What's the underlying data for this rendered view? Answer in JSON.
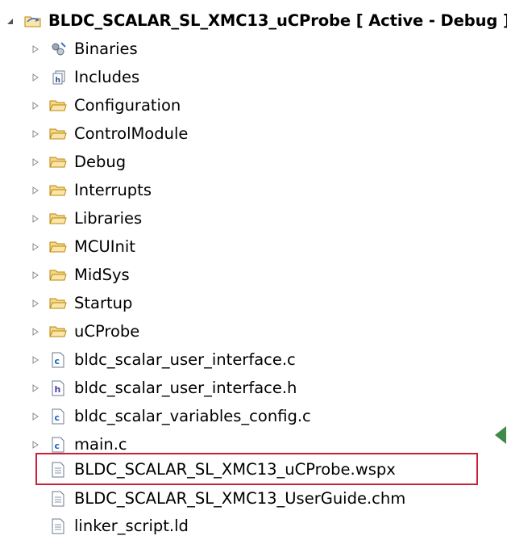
{
  "explorer": {
    "root": {
      "label": "BLDC_SCALAR_SL_XMC13_uCProbe [ Active - Debug ]",
      "icon": "project-folder-icon"
    },
    "items": [
      {
        "label": "Binaries",
        "icon": "binaries-icon",
        "expandable": true
      },
      {
        "label": "Includes",
        "icon": "includes-icon",
        "expandable": true
      },
      {
        "label": "Configuration",
        "icon": "folder-icon",
        "expandable": true
      },
      {
        "label": "ControlModule",
        "icon": "folder-icon",
        "expandable": true
      },
      {
        "label": "Debug",
        "icon": "folder-icon",
        "expandable": true
      },
      {
        "label": "Interrupts",
        "icon": "folder-icon",
        "expandable": true
      },
      {
        "label": "Libraries",
        "icon": "folder-icon",
        "expandable": true
      },
      {
        "label": "MCUInit",
        "icon": "folder-icon",
        "expandable": true
      },
      {
        "label": "MidSys",
        "icon": "folder-icon",
        "expandable": true
      },
      {
        "label": "Startup",
        "icon": "folder-icon",
        "expandable": true
      },
      {
        "label": "uCProbe",
        "icon": "folder-icon",
        "expandable": true
      },
      {
        "label": "bldc_scalar_user_interface.c",
        "icon": "c-file-icon",
        "expandable": true
      },
      {
        "label": "bldc_scalar_user_interface.h",
        "icon": "h-file-icon",
        "expandable": true
      },
      {
        "label": "bldc_scalar_variables_config.c",
        "icon": "c-file-icon",
        "expandable": true
      },
      {
        "label": "main.c",
        "icon": "c-file-icon",
        "expandable": true
      },
      {
        "label": "BLDC_SCALAR_SL_XMC13_uCProbe.wspx",
        "icon": "text-file-icon",
        "expandable": false,
        "highlighted": true
      },
      {
        "label": "BLDC_SCALAR_SL_XMC13_UserGuide.chm",
        "icon": "text-file-icon",
        "expandable": false
      },
      {
        "label": "linker_script.ld",
        "icon": "text-file-icon",
        "expandable": false
      }
    ]
  },
  "colors": {
    "highlight_border": "#cc1f3a",
    "folder_fill": "#f5d88a",
    "folder_stroke": "#b8860b",
    "c_file_letter": "#1f5fbf",
    "h_file_letter": "#4b3fa8"
  }
}
